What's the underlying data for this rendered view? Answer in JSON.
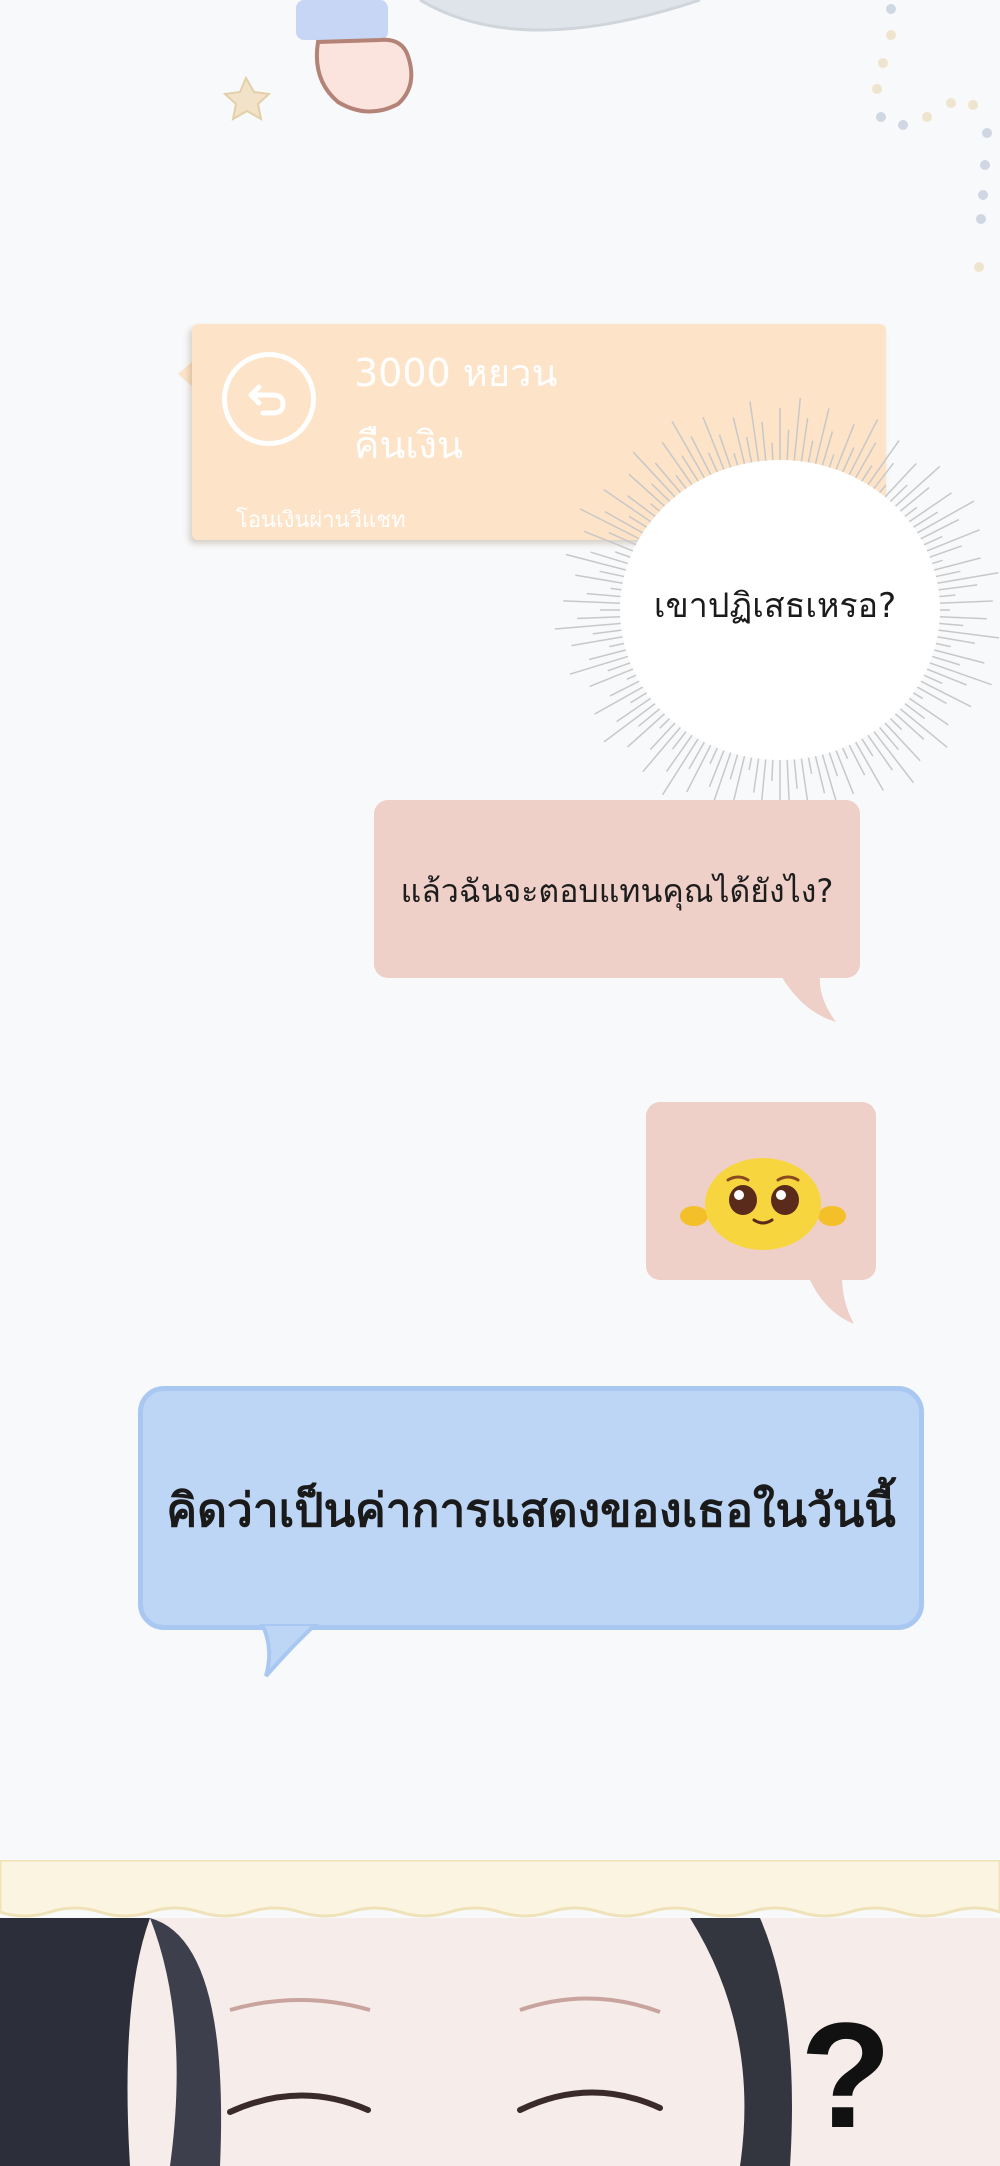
{
  "transfer_card": {
    "amount": "3000 หยวน",
    "status": "คืนเงิน",
    "footer": "โอนเงินผ่านวีแชท",
    "icon": "refund-arrow-icon",
    "color": "#fde3c7"
  },
  "burst_bubble": {
    "text": "เขาปฏิเสธเหรอ?"
  },
  "messages": [
    {
      "text": "แล้วฉันจะตอบแทนคุณได้ยังไง?",
      "color": "#efd0c8"
    },
    {
      "sticker": "pleading-emoji-sticker",
      "color": "#efd0c8"
    },
    {
      "text": "คิดว่าเป็นค่าการแสดงของเธอในวันนี้",
      "color": "#bed6f5"
    }
  ],
  "panel": {
    "mark": "?"
  }
}
